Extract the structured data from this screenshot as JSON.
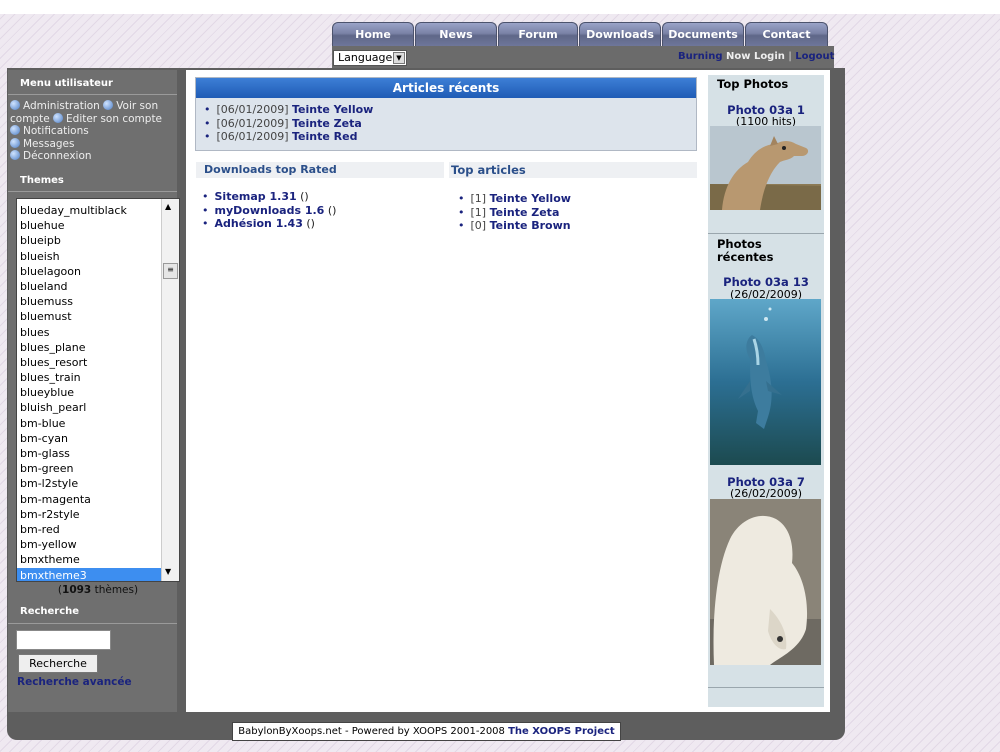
{
  "nav": {
    "tabs": [
      "Home",
      "News",
      "Forum",
      "Downloads",
      "Documents",
      "Contact"
    ],
    "language_label": "Language",
    "user_name": "Burning",
    "user_status": "Now Login",
    "logout_label": "Logout"
  },
  "left": {
    "menu_heading": "Menu utilisateur",
    "menu_items": [
      "Administration",
      "Voir son compte",
      "Editer son compte",
      "Notifications",
      "Messages",
      "Déconnexion"
    ],
    "themes_heading": "Themes",
    "themes": [
      "blueday_multiblack",
      "bluehue",
      "blueipb",
      "blueish",
      "bluelagoon",
      "blueland",
      "bluemuss",
      "bluemust",
      "blues",
      "blues_plane",
      "blues_resort",
      "blues_train",
      "blueyblue",
      "bluish_pearl",
      "bm-blue",
      "bm-cyan",
      "bm-glass",
      "bm-green",
      "bm-l2style",
      "bm-magenta",
      "bm-r2style",
      "bm-red",
      "bm-yellow",
      "bmxtheme",
      "bmxtheme3"
    ],
    "selected_theme": "bmxtheme3",
    "theme_count": "1093",
    "theme_count_suffix": " thèmes)",
    "search_heading": "Recherche",
    "search_button": "Recherche",
    "advanced_search": "Recherche avancée"
  },
  "center": {
    "recent_title": "Articles récents",
    "recent": [
      {
        "date": "[06/01/2009]",
        "title": "Teinte Yellow"
      },
      {
        "date": "[06/01/2009]",
        "title": "Teinte Zeta"
      },
      {
        "date": "[06/01/2009]",
        "title": "Teinte Red"
      }
    ],
    "downloads_heading": "Downloads top Rated",
    "downloads": [
      {
        "title": "Sitemap 1.31",
        "extra": "()"
      },
      {
        "title": "myDownloads 1.6",
        "extra": "()"
      },
      {
        "title": "Adhésion 1.43",
        "extra": "()"
      }
    ],
    "top_heading": "Top articles",
    "top": [
      {
        "count": "[1]",
        "title": "Teinte Yellow"
      },
      {
        "count": "[1]",
        "title": "Teinte Zeta"
      },
      {
        "count": "[0]",
        "title": "Teinte Brown"
      }
    ]
  },
  "right": {
    "top_photos_heading": "Top Photos",
    "top_photo": {
      "title": "Photo 03a 1",
      "sub": "(1100 hits)"
    },
    "recent_heading_1": "Photos",
    "recent_heading_2": "récentes",
    "recent_photos": [
      {
        "title": "Photo 03a 13",
        "sub": "(26/02/2009)"
      },
      {
        "title": "Photo 03a 7",
        "sub": "(26/02/2009)"
      }
    ]
  },
  "footer": {
    "text": "BabylonByXoops.net - Powered by XOOPS 2001-2008 ",
    "link": "The XOOPS Project"
  }
}
